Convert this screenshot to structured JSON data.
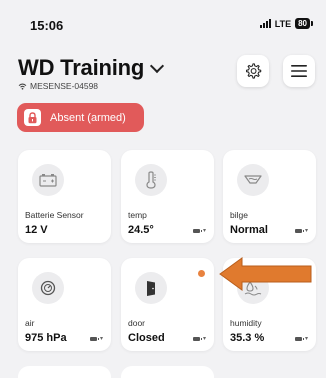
{
  "status_bar": {
    "time": "15:06",
    "network": "LTE",
    "battery": "80"
  },
  "header": {
    "title": "WD Training",
    "device_id": "MESENSE-04598"
  },
  "mode": {
    "label": "Absent (armed)"
  },
  "devices": [
    {
      "name": "Batterie Sensor",
      "value": "12 V",
      "icon": "battery-icon",
      "show_meta": false,
      "alert": false
    },
    {
      "name": "temp",
      "value": "24.5°",
      "icon": "thermometer-icon",
      "show_meta": true,
      "alert": false
    },
    {
      "name": "bilge",
      "value": "Normal",
      "icon": "bilge-icon",
      "show_meta": true,
      "alert": false
    },
    {
      "name": "air",
      "value": "975 hPa",
      "icon": "gauge-icon",
      "show_meta": true,
      "alert": false
    },
    {
      "name": "door",
      "value": "Closed",
      "icon": "door-icon",
      "show_meta": true,
      "alert": true
    },
    {
      "name": "humidity",
      "value": "35.3 %",
      "icon": "humidity-icon",
      "show_meta": true,
      "alert": false
    }
  ],
  "colors": {
    "absent": "#e15a5a",
    "alert_dot": "#e8823f",
    "arrow": "#e07a2e"
  }
}
